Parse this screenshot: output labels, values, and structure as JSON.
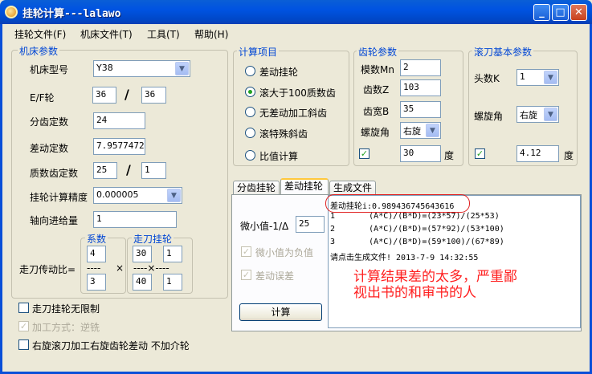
{
  "window": {
    "title": "挂轮计算---lalawo",
    "min": "_",
    "max": "□",
    "close": "✕"
  },
  "menu": [
    "挂轮文件(F)",
    "机床文件(T)",
    "工具(T)",
    "帮助(H)"
  ],
  "machine": {
    "group_label": "机床参数",
    "model_label": "机床型号",
    "model_value": "Y38",
    "ef_label": "E/F轮",
    "ef_a": "36",
    "ef_b": "36",
    "slash": "/",
    "index_label": "分齿定数",
    "index_value": "24",
    "diff_label": "差动定数",
    "diff_value": "7.9577472",
    "prime_label": "质数齿定数",
    "prime_a": "25",
    "prime_b": "1",
    "precision_label": "挂轮计算精度",
    "precision_value": "0.000005",
    "axial_label": "轴向进给量",
    "axial_value": "1",
    "ratio_label": "走刀传动比=",
    "coef_label": "系数",
    "coef_top": "4",
    "coef_bottom": "3",
    "coef_line": "----",
    "times": "×",
    "feed_label": "走刀挂轮",
    "feed_a": "30",
    "feed_b": "1",
    "feed_c": "40",
    "feed_d": "1",
    "feed_line": "----×----"
  },
  "calc": {
    "group_label": "计算项目",
    "items": [
      "差动挂轮",
      "滚大于100质数齿",
      "无差动加工斜齿",
      "滚特殊斜齿",
      "比值计算"
    ],
    "selected": 1
  },
  "gear": {
    "group_label": "齿轮参数",
    "module_label": "模数Mn",
    "module_value": "2",
    "teeth_label": "齿数Z",
    "teeth_value": "103",
    "width_label": "齿宽B",
    "width_value": "35",
    "helix_label": "螺旋角",
    "helix_value": "右旋",
    "angle_value": "30",
    "angle_unit": "度",
    "check": "✓"
  },
  "hob": {
    "group_label": "滚刀基本参数",
    "starts_label": "头数K",
    "starts_value": "1",
    "helix_label": "螺旋角",
    "helix_value": "右旋",
    "angle_value": "4.12",
    "angle_unit": "度",
    "check": "✓"
  },
  "tabs": [
    "分齿挂轮",
    "差动挂轮",
    "生成文件"
  ],
  "active_tab": 1,
  "diffpanel": {
    "small_label": "微小值-1/Δ",
    "small_value": "25",
    "neg_label": "微小值为负值",
    "err_label": "差动误差",
    "calc_button": "计算"
  },
  "results": [
    "差动挂轮i:0.989436745643616",
    "1       (A*C)/(B*D)=(23*57)/(25*53)",
    "2       (A*C)/(B*D)=(57*92)/(53*100)",
    "3       (A*C)/(B*D)=(59*100)/(67*89)",
    "请点击生成文件! 2013-7-9 14:32:55"
  ],
  "annotation": [
    "计算结果差的太多，严重鄙",
    "视出书的和审书的人"
  ],
  "bottom": {
    "unlimited": "走刀挂轮无限制",
    "method": "加工方式：逆铣",
    "right_hob": "右旋滚刀加工右旋齿轮差动 不加介轮"
  },
  "colors": {
    "titlebar": "#0053e1",
    "group_label": "#0046d5",
    "annotation": "#ff2020",
    "active_tab": "#ffc83c"
  }
}
